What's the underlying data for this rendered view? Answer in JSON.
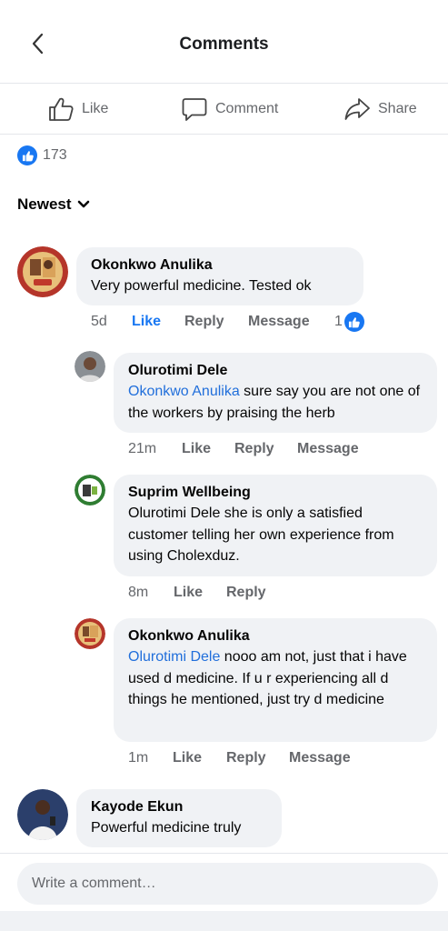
{
  "header": {
    "title": "Comments"
  },
  "actions": {
    "like": "Like",
    "comment": "Comment",
    "share": "Share"
  },
  "reactions": {
    "count": "173"
  },
  "sort": {
    "label": "Newest"
  },
  "comments": [
    {
      "author": "Okonkwo Anulika",
      "text": "Very powerful medicine. Tested ok",
      "time": "5d",
      "like": "Like",
      "reply": "Reply",
      "message": "Message",
      "reaction_count": "1"
    },
    {
      "author": "Olurotimi Dele",
      "mention": "Okonkwo Anulika",
      "text": " sure say you are not one of the workers by praising the herb",
      "time": "21m",
      "like": "Like",
      "reply": "Reply",
      "message": "Message"
    },
    {
      "author": "Suprim Wellbeing",
      "text": "Olurotimi Dele she is only a satisfied customer telling her own experience from using Cholexduz.",
      "time": "8m",
      "like": "Like",
      "reply": "Reply"
    },
    {
      "author": "Okonkwo Anulika",
      "mention": "Olurotimi Dele",
      "text": " nooo am not, just that i have used d medicine. If u r experiencing all d things he mentioned, just try d medicine",
      "time": "1m",
      "like": "Like",
      "reply": "Reply",
      "message": "Message"
    },
    {
      "author": "Kayode Ekun",
      "text": "Powerful medicine truly"
    }
  ],
  "composer": {
    "placeholder": "Write a comment…"
  },
  "colors": {
    "accent": "#1877f2",
    "bubble": "#f0f2f5",
    "secondary_text": "#65676b",
    "mention": "#216fdb"
  }
}
